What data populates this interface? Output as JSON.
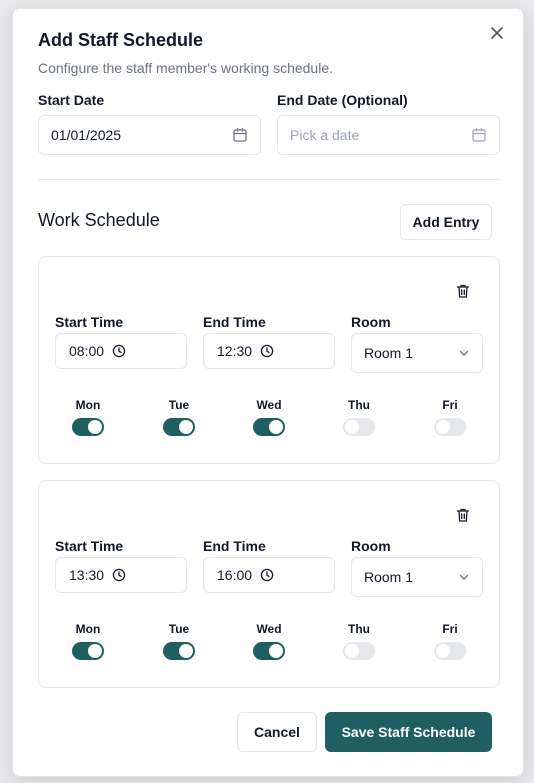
{
  "dialog": {
    "title": "Add Staff Schedule",
    "subtitle": "Configure the staff member's working schedule.",
    "close_icon": "close-icon"
  },
  "start_date": {
    "label": "Start Date",
    "value": "01/01/2025",
    "icon": "calendar-icon"
  },
  "end_date": {
    "label": "End Date (Optional)",
    "placeholder": "Pick a date",
    "icon": "calendar-icon"
  },
  "work_schedule": {
    "title": "Work Schedule",
    "add_entry_label": "Add Entry",
    "entries": [
      {
        "start_time_label": "Start Time",
        "start_time": "08:00",
        "end_time_label": "End Time",
        "end_time": "12:30",
        "room_label": "Room",
        "room": "Room 1",
        "days": [
          {
            "label": "Mon",
            "enabled": true
          },
          {
            "label": "Tue",
            "enabled": true
          },
          {
            "label": "Wed",
            "enabled": true
          },
          {
            "label": "Thu",
            "enabled": false
          },
          {
            "label": "Fri",
            "enabled": false
          }
        ]
      },
      {
        "start_time_label": "Start Time",
        "start_time": "13:30",
        "end_time_label": "End Time",
        "end_time": "16:00",
        "room_label": "Room",
        "room": "Room 1",
        "days": [
          {
            "label": "Mon",
            "enabled": true
          },
          {
            "label": "Tue",
            "enabled": true
          },
          {
            "label": "Wed",
            "enabled": true
          },
          {
            "label": "Thu",
            "enabled": false
          },
          {
            "label": "Fri",
            "enabled": false
          }
        ]
      }
    ]
  },
  "footer": {
    "cancel_label": "Cancel",
    "save_label": "Save Staff Schedule"
  },
  "colors": {
    "primary": "#1f5f62",
    "toggle_off": "#e5e7eb",
    "border": "#e5e7eb",
    "muted_text": "#6b7280"
  }
}
